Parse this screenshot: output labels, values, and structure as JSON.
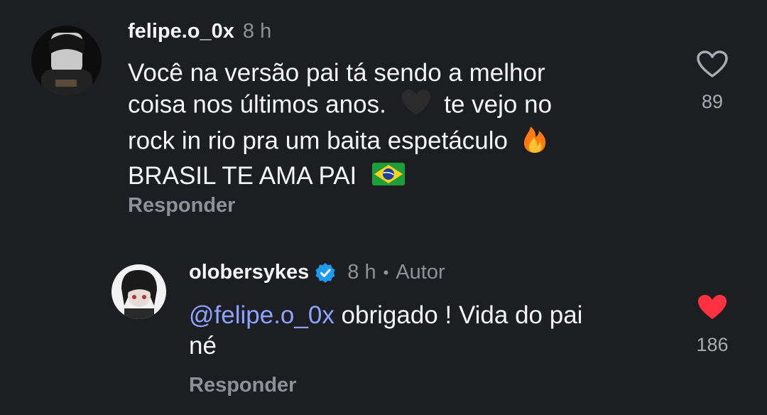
{
  "comment": {
    "username": "felipe.o_0x",
    "time": "8 h",
    "lines": [
      "Você na versão pai tá sendo a melhor",
      "coisa nos últimos anos.",
      "te vejo no",
      "rock in rio pra um baita espetáculo",
      "BRASIL TE AMA PAI"
    ],
    "reply_label": "Responder",
    "likes": "89",
    "liked": false
  },
  "reply": {
    "username": "olobersykes",
    "verified": true,
    "time": "8 h",
    "separator": "•",
    "author_label": "Autor",
    "mention": "@felipe.o_0x",
    "text_line1": " obrigado ! Vida do pai",
    "text_line2": "né",
    "reply_label": "Responder",
    "likes": "186",
    "liked": true
  },
  "colors": {
    "background": "#1c1e22",
    "liked_heart": "#ff3040",
    "mention": "#8ea3ff",
    "verified_badge": "#1d9bf0"
  },
  "icons": [
    "heart-outline-icon",
    "heart-filled-icon",
    "verified-badge-icon",
    "black-heart-emoji",
    "fire-emoji",
    "brazil-flag-emoji"
  ]
}
